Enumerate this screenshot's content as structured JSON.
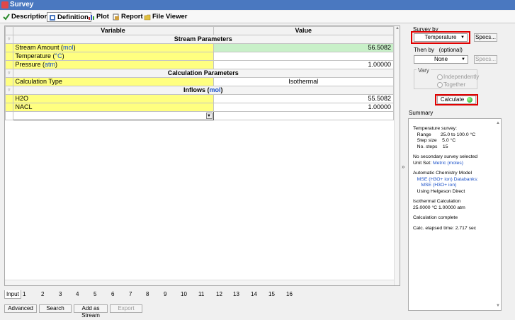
{
  "window": {
    "title": "Survey"
  },
  "tabs": [
    {
      "label": "Description",
      "icon": "check-icon"
    },
    {
      "label": "Definition",
      "icon": "definition-icon"
    },
    {
      "label": "Plot",
      "icon": "plot-icon"
    },
    {
      "label": "Report",
      "icon": "report-icon"
    },
    {
      "label": "File Viewer",
      "icon": "folder-icon"
    }
  ],
  "grid": {
    "headers": {
      "variable": "Variable",
      "value": "Value"
    },
    "sections": {
      "stream": "Stream Parameters",
      "calc": "Calculation Parameters",
      "inflows_prefix": "Inflows (",
      "inflows_unit": "mol",
      "inflows_suffix": ")"
    },
    "stream_amount": {
      "label": "Stream Amount (",
      "unit": "mol",
      "suffix": ")",
      "value": "56.5082"
    },
    "temperature": {
      "label": "Temperature (",
      "unit": "°C",
      "suffix": ")",
      "value": ""
    },
    "pressure": {
      "label": "Pressure (",
      "unit": "atm",
      "suffix": ")",
      "value": "1.00000"
    },
    "calc_type": {
      "label": "Calculation Type",
      "value": "Isothermal"
    },
    "h2o": {
      "label": "H2O",
      "value": "55.5082"
    },
    "nacl": {
      "label": "NACL",
      "value": "1.00000"
    }
  },
  "bottom_tabs": [
    "Input",
    "1",
    "2",
    "3",
    "4",
    "5",
    "6",
    "7",
    "8",
    "9",
    "10",
    "11",
    "12",
    "13",
    "14",
    "15",
    "16"
  ],
  "buttons": {
    "advanced": "Advanced",
    "search": "Search",
    "add_as_stream": "Add as Stream",
    "export": "Export"
  },
  "right": {
    "survey_by_label": "Survey by",
    "survey_by_value": "Temperature",
    "specs1": "Specs...",
    "then_by_label": "Then by",
    "then_by_optional": "(optional)",
    "then_by_value": "None",
    "specs2": "Specs...",
    "vary_label": "Vary",
    "independently": "Independently",
    "together": "Together",
    "calculate": "Calculate",
    "summary_label": "Summary",
    "splitter": "»"
  },
  "summary": {
    "l1": "Temperature survey:",
    "l2": "   Range       25.0 to 100.0 °C",
    "l3": "   Step size    5.0 °C",
    "l4": "   No. steps    15",
    "l5": "No secondary survey selected",
    "l6_prefix": "Unit Set: ",
    "l6_blue": "Metric (moles)",
    "l7": "Automatic Chemistry Model",
    "l8": "   MSE (H3O+ ion) Databanks:",
    "l9": "      MSE (H3O+ ion)",
    "l10": "   Using Helgeson Direct",
    "l11": "Isothermal Calculation",
    "l12": "25.0000 °C 1.00000 atm",
    "l13": "Calculation complete",
    "l14": "Calc. elapsed time: 2.717 sec"
  }
}
